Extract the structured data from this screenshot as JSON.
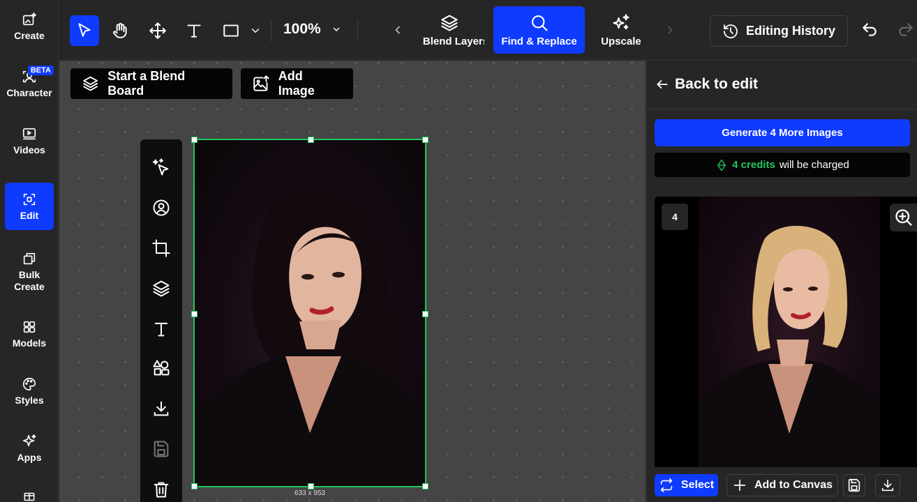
{
  "sidebar": {
    "items": [
      {
        "label": "Create",
        "icon": "image-sparkle-icon"
      },
      {
        "label": "Character",
        "icon": "character-icon",
        "badge": "BETA"
      },
      {
        "label": "Videos",
        "icon": "video-icon"
      },
      {
        "label": "Edit",
        "icon": "edit-frame-icon",
        "active": true
      },
      {
        "label": "Bulk Create",
        "icon": "copy-icon"
      },
      {
        "label": "Models",
        "icon": "grid-icon"
      },
      {
        "label": "Styles",
        "icon": "palette-icon"
      },
      {
        "label": "Apps",
        "icon": "sparkle-icon"
      }
    ]
  },
  "toolbar": {
    "zoom": "100%",
    "features": [
      {
        "label": "Blend Layers",
        "icon": "layers-plus-icon"
      },
      {
        "label": "Find & Replace",
        "icon": "search-icon",
        "active": true
      },
      {
        "label": "Upscale",
        "icon": "upscale-sparkle-icon"
      }
    ],
    "history_label": "Editing History"
  },
  "canvas": {
    "blend_board_label": "Start a Blend Board",
    "add_image_label": "Add Image",
    "selection_dims": "633 x 953"
  },
  "panel": {
    "back_label": "Back to edit",
    "generate_label": "Generate 4 More Images",
    "credits_amount": "4 credits",
    "credits_suffix": "will be charged",
    "result_index": "4",
    "select_label": "Select",
    "add_to_canvas_label": "Add to Canvas"
  },
  "colors": {
    "accent": "#0f3bff",
    "selection": "#22c55e",
    "credits": "#22c55e"
  }
}
